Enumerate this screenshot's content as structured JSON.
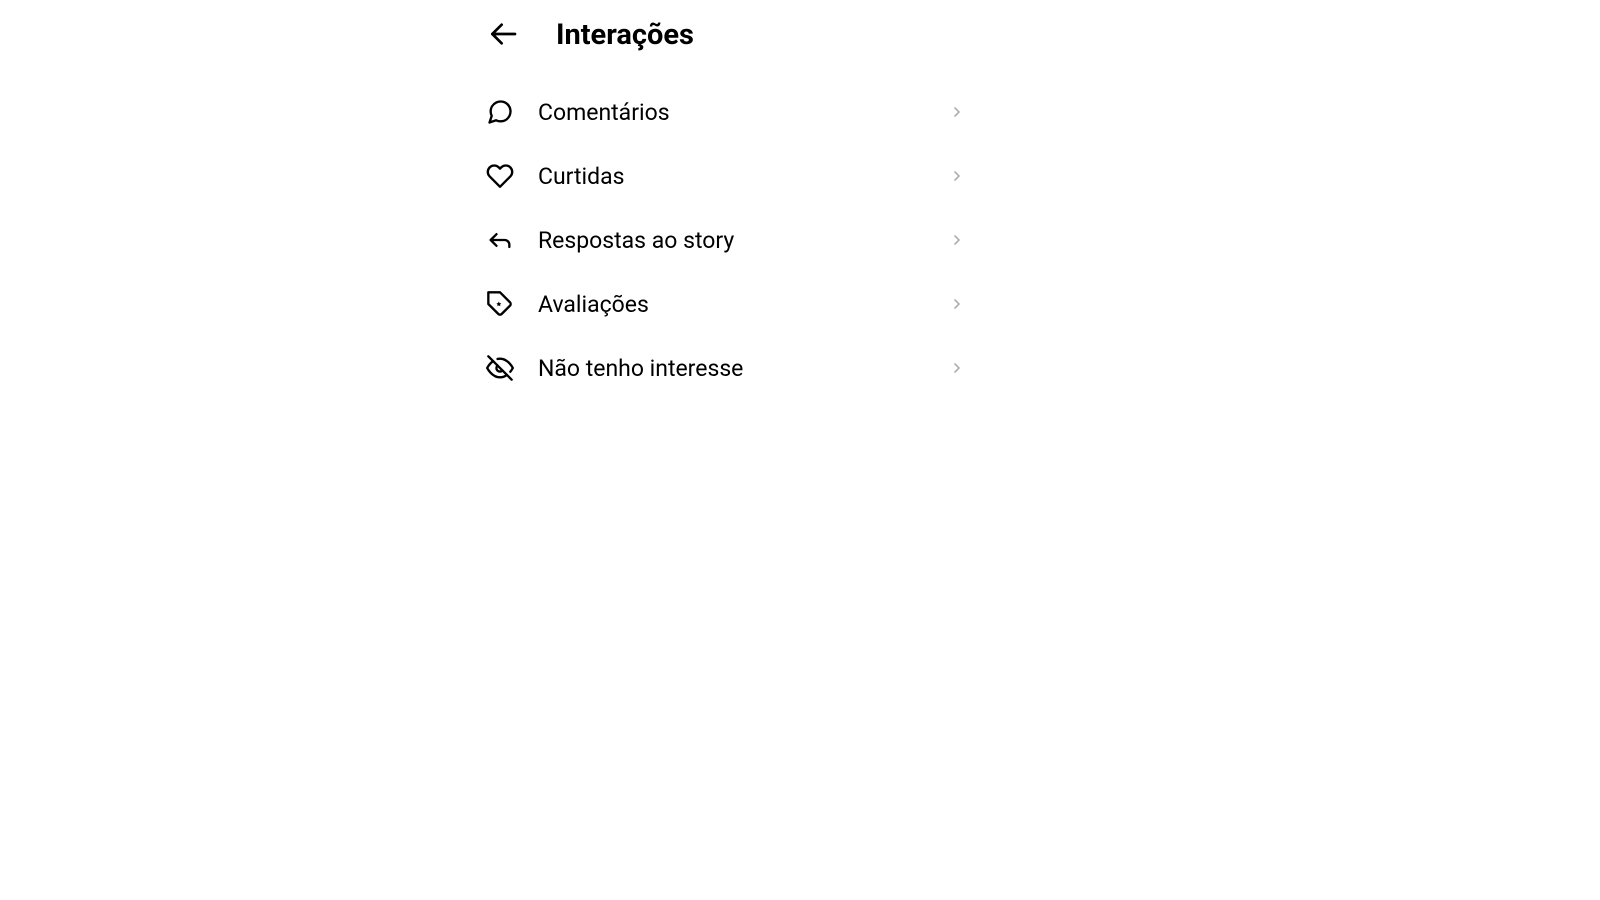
{
  "header": {
    "title": "Interações"
  },
  "menu": {
    "items": [
      {
        "label": "Comentários",
        "icon": "comment-icon"
      },
      {
        "label": "Curtidas",
        "icon": "heart-icon"
      },
      {
        "label": "Respostas ao story",
        "icon": "reply-icon"
      },
      {
        "label": "Avaliações",
        "icon": "tag-star-icon"
      },
      {
        "label": "Não tenho interesse",
        "icon": "eye-off-icon"
      }
    ]
  }
}
